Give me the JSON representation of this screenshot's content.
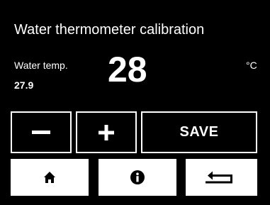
{
  "header": {
    "title": "Water thermometer calibration"
  },
  "reading": {
    "label": "Water temp.",
    "raw_value": "27.9",
    "display_value": "28",
    "unit": "°C"
  },
  "controls": {
    "decrement_icon": "minus-icon",
    "increment_icon": "plus-icon",
    "save_label": "SAVE"
  },
  "nav": {
    "home_icon": "home-icon",
    "info_icon": "info-icon",
    "back_icon": "return-arrow-icon"
  },
  "colors": {
    "background": "#000000",
    "foreground": "#ffffff"
  }
}
